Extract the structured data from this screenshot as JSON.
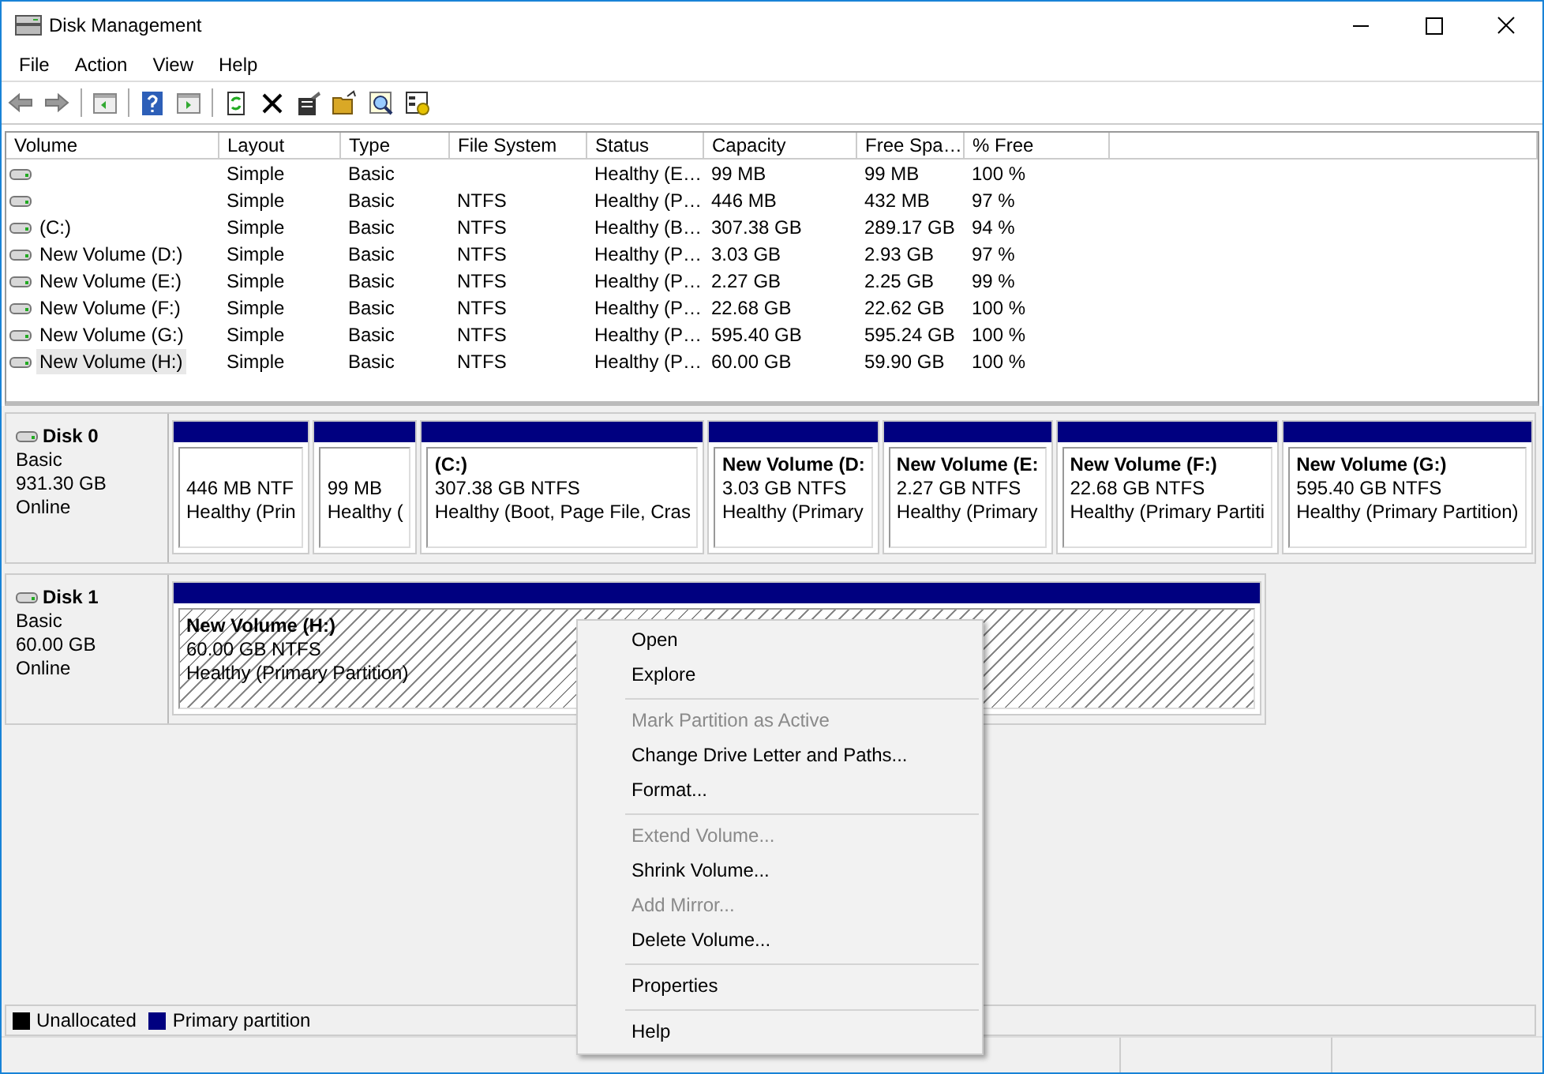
{
  "window": {
    "title": "Disk Management"
  },
  "menu": [
    "File",
    "Action",
    "View",
    "Help"
  ],
  "volumes": {
    "columns": [
      "Volume",
      "Layout",
      "Type",
      "File System",
      "Status",
      "Capacity",
      "Free Spa…",
      "% Free"
    ],
    "rows": [
      {
        "cells": [
          "",
          "Simple",
          "Basic",
          "",
          "Healthy (E…",
          "99 MB",
          "99 MB",
          "100 %"
        ],
        "selected": false
      },
      {
        "cells": [
          "",
          "Simple",
          "Basic",
          "NTFS",
          "Healthy (P…",
          "446 MB",
          "432 MB",
          "97 %"
        ],
        "selected": false
      },
      {
        "cells": [
          "(C:)",
          "Simple",
          "Basic",
          "NTFS",
          "Healthy (B…",
          "307.38 GB",
          "289.17 GB",
          "94 %"
        ],
        "selected": false
      },
      {
        "cells": [
          "New Volume (D:)",
          "Simple",
          "Basic",
          "NTFS",
          "Healthy (P…",
          "3.03 GB",
          "2.93 GB",
          "97 %"
        ],
        "selected": false
      },
      {
        "cells": [
          "New Volume (E:)",
          "Simple",
          "Basic",
          "NTFS",
          "Healthy (P…",
          "2.27 GB",
          "2.25 GB",
          "99 %"
        ],
        "selected": false
      },
      {
        "cells": [
          "New Volume (F:)",
          "Simple",
          "Basic",
          "NTFS",
          "Healthy (P…",
          "22.68 GB",
          "22.62 GB",
          "100 %"
        ],
        "selected": false
      },
      {
        "cells": [
          "New Volume (G:)",
          "Simple",
          "Basic",
          "NTFS",
          "Healthy (P…",
          "595.40 GB",
          "595.24 GB",
          "100 %"
        ],
        "selected": false
      },
      {
        "cells": [
          "New Volume (H:)",
          "Simple",
          "Basic",
          "NTFS",
          "Healthy (P…",
          "60.00 GB",
          "59.90 GB",
          "100 %"
        ],
        "selected": true
      }
    ]
  },
  "disks": [
    {
      "name": "Disk 0",
      "type": "Basic",
      "size": "931.30 GB",
      "status": "Online",
      "partitions": [
        {
          "size": "446 MB NTF",
          "status": "Healthy (Prin",
          "selected": false
        },
        {
          "size": "99 MB",
          "status": "Healthy (",
          "selected": false
        },
        {
          "name": "(C:)",
          "size": "307.38 GB NTFS",
          "status": "Healthy (Boot, Page File, Cras",
          "selected": false
        },
        {
          "name": "New Volume  (D:",
          "size": "3.03 GB NTFS",
          "status": "Healthy (Primary",
          "selected": false
        },
        {
          "name": "New Volume  (E:",
          "size": "2.27 GB NTFS",
          "status": "Healthy (Primary",
          "selected": false
        },
        {
          "name": "New Volume  (F:)",
          "size": "22.68 GB NTFS",
          "status": "Healthy (Primary Partiti",
          "selected": false
        },
        {
          "name": "New Volume  (G:)",
          "size": "595.40 GB NTFS",
          "status": "Healthy (Primary Partition)",
          "selected": false
        }
      ]
    },
    {
      "name": "Disk 1",
      "type": "Basic",
      "size": "60.00 GB",
      "status": "Online",
      "partitions": [
        {
          "name": "New Volume  (H:)",
          "size": "60.00 GB NTFS",
          "status": "Healthy (Primary Partition)",
          "selected": true
        }
      ]
    }
  ],
  "legend": [
    {
      "label": "Unallocated",
      "color": "#000000"
    },
    {
      "label": "Primary partition",
      "color": "#000080"
    }
  ],
  "context_menu": [
    {
      "kind": "item",
      "label": "Open",
      "disabled": false
    },
    {
      "kind": "item",
      "label": "Explore",
      "disabled": false
    },
    {
      "kind": "separator"
    },
    {
      "kind": "item",
      "label": "Mark Partition as Active",
      "disabled": true
    },
    {
      "kind": "item",
      "label": "Change Drive Letter and Paths...",
      "disabled": false
    },
    {
      "kind": "item",
      "label": "Format...",
      "disabled": false
    },
    {
      "kind": "separator"
    },
    {
      "kind": "item",
      "label": "Extend Volume...",
      "disabled": true
    },
    {
      "kind": "item",
      "label": "Shrink Volume...",
      "disabled": false
    },
    {
      "kind": "item",
      "label": "Add Mirror...",
      "disabled": true
    },
    {
      "kind": "item",
      "label": "Delete Volume...",
      "disabled": false
    },
    {
      "kind": "separator"
    },
    {
      "kind": "item",
      "label": "Properties",
      "disabled": false
    },
    {
      "kind": "separator"
    },
    {
      "kind": "item",
      "label": "Help",
      "disabled": false
    }
  ]
}
